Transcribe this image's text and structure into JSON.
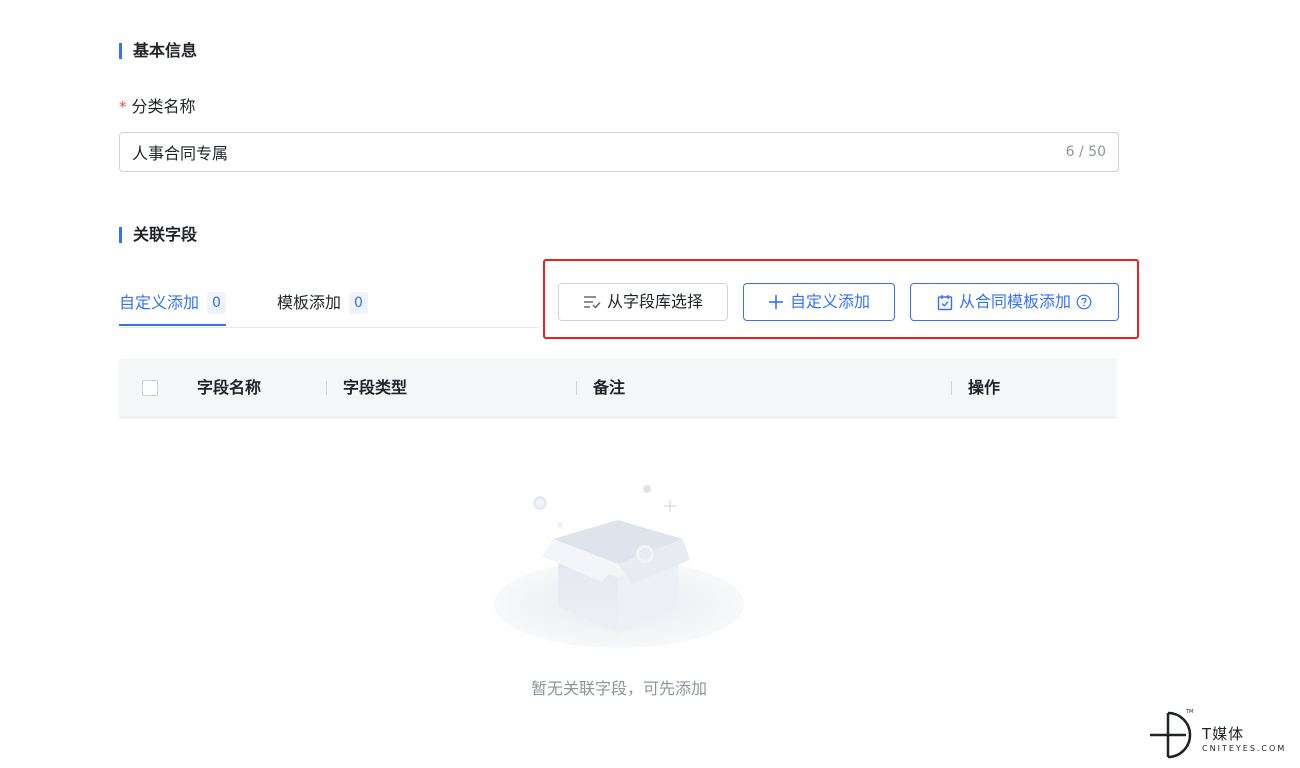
{
  "basic_info": {
    "section_title": "基本信息",
    "field_label": "分类名称",
    "required_mark": "*",
    "input_value": "人事合同专属",
    "char_count": "6 / 50"
  },
  "related_fields": {
    "section_title": "关联字段",
    "tabs": [
      {
        "label": "自定义添加",
        "count": "0",
        "active": true
      },
      {
        "label": "模板添加",
        "count": "0",
        "active": false
      }
    ],
    "actions": {
      "select_from_library": "从字段库选择",
      "custom_add": "自定义添加",
      "add_from_contract_template": "从合同模板添加"
    },
    "table": {
      "columns": [
        "字段名称",
        "字段类型",
        "备注",
        "操作"
      ]
    },
    "empty_text": "暂无关联字段，可先添加"
  },
  "watermark": {
    "title": "T媒体",
    "subtitle": "CNITEYES.COM",
    "tm": "TM"
  },
  "colors": {
    "primary": "#3370ff",
    "highlight": "#e8231f",
    "required": "#f54a45",
    "muted_text": "#8f959e"
  }
}
